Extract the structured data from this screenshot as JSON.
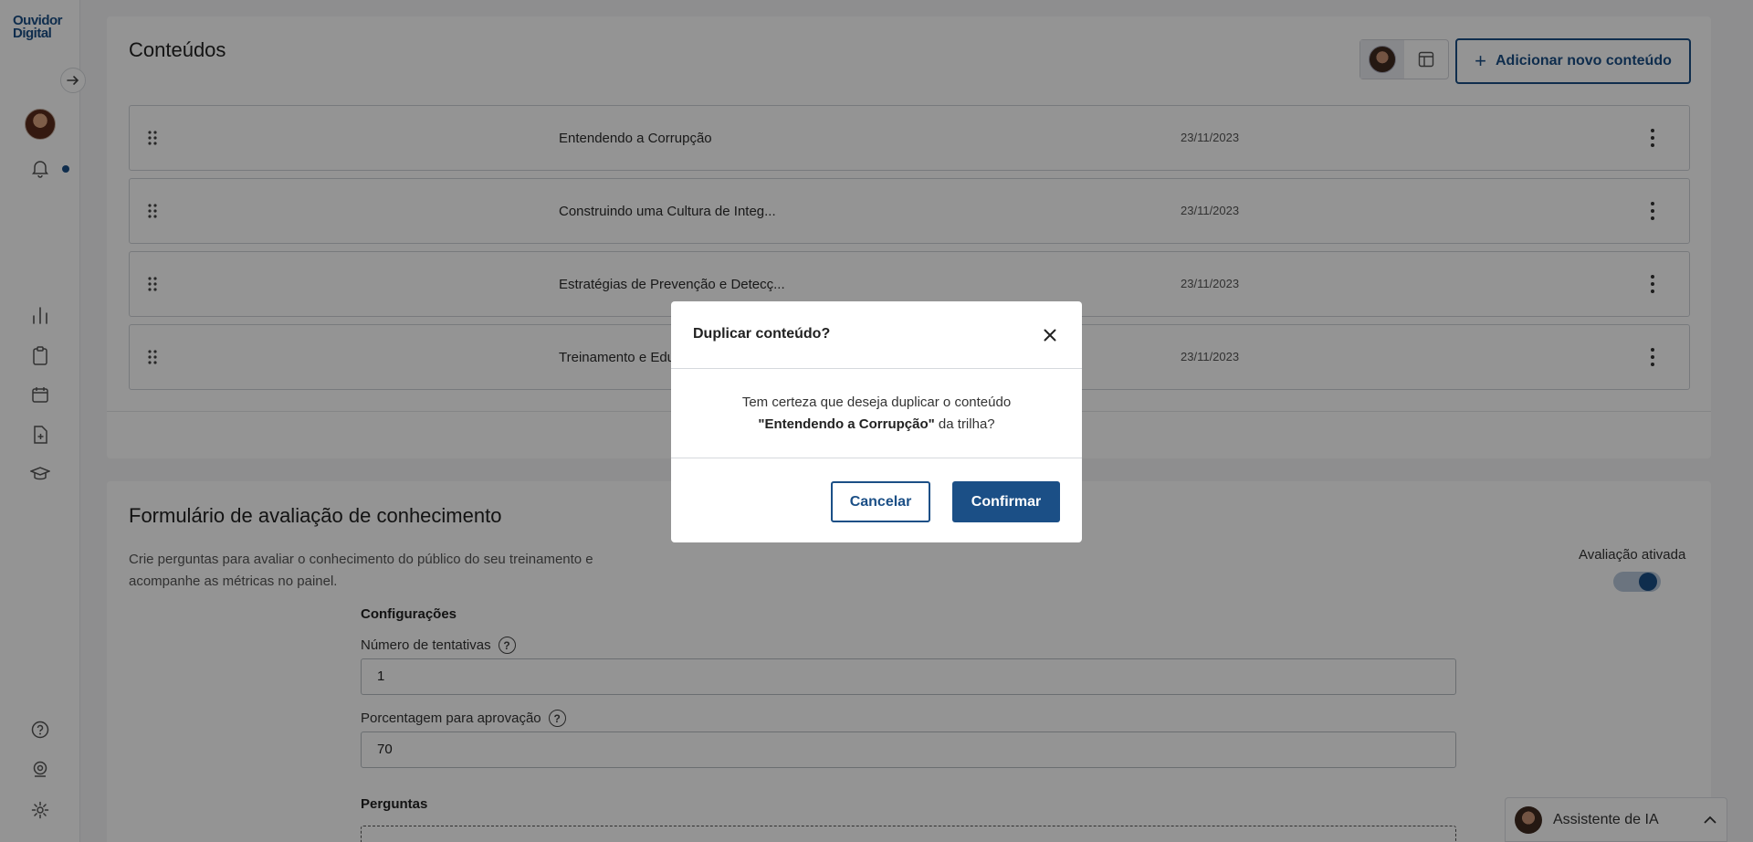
{
  "sidebar": {
    "logo_line1": "Ouvidor",
    "logo_line2": "Digital",
    "icons": [
      "arrow-right-icon",
      "avatar",
      "bell-icon",
      "bar-chart-icon",
      "clipboard-icon",
      "calendar-icon",
      "file-plus-icon",
      "graduation-cap-icon",
      "help-circle-icon",
      "location-pin-icon",
      "gear-icon"
    ]
  },
  "conteudos": {
    "title": "Conteúdos",
    "add_button": "Adicionar novo conteúdo",
    "rows": [
      {
        "title": "Entendendo a Corrupção",
        "date": "23/11/2023"
      },
      {
        "title": "Construindo uma Cultura de Integ...",
        "date": "23/11/2023"
      },
      {
        "title": "Estratégias de Prevenção e Detecç...",
        "date": "23/11/2023"
      },
      {
        "title": "Treinamento e Edu",
        "date": "23/11/2023"
      }
    ]
  },
  "form": {
    "title": "Formulário de avaliação de conhecimento",
    "description": "Crie perguntas para avaliar o conhecimento do público do seu treinamento e acompanhe as métricas no painel.",
    "evaluation_label": "Avaliação ativada",
    "evaluation_enabled": true,
    "config_label": "Configurações",
    "attempts_label": "Número de tentativas",
    "attempts_value": "1",
    "approval_label": "Porcentagem para aprovação",
    "approval_value": "70",
    "questions_label": "Perguntas"
  },
  "assistant": {
    "label": "Assistente de IA"
  },
  "modal": {
    "title": "Duplicar conteúdo?",
    "body_prefix": "Tem certeza que deseja duplicar o conteúdo",
    "content_name": "\"Entendendo a Corrupção\"",
    "body_suffix": "da trilha?",
    "cancel": "Cancelar",
    "confirm": "Confirmar"
  },
  "colors": {
    "primary": "#1b4f86",
    "overlay": "rgba(0,0,0,0.42)"
  }
}
